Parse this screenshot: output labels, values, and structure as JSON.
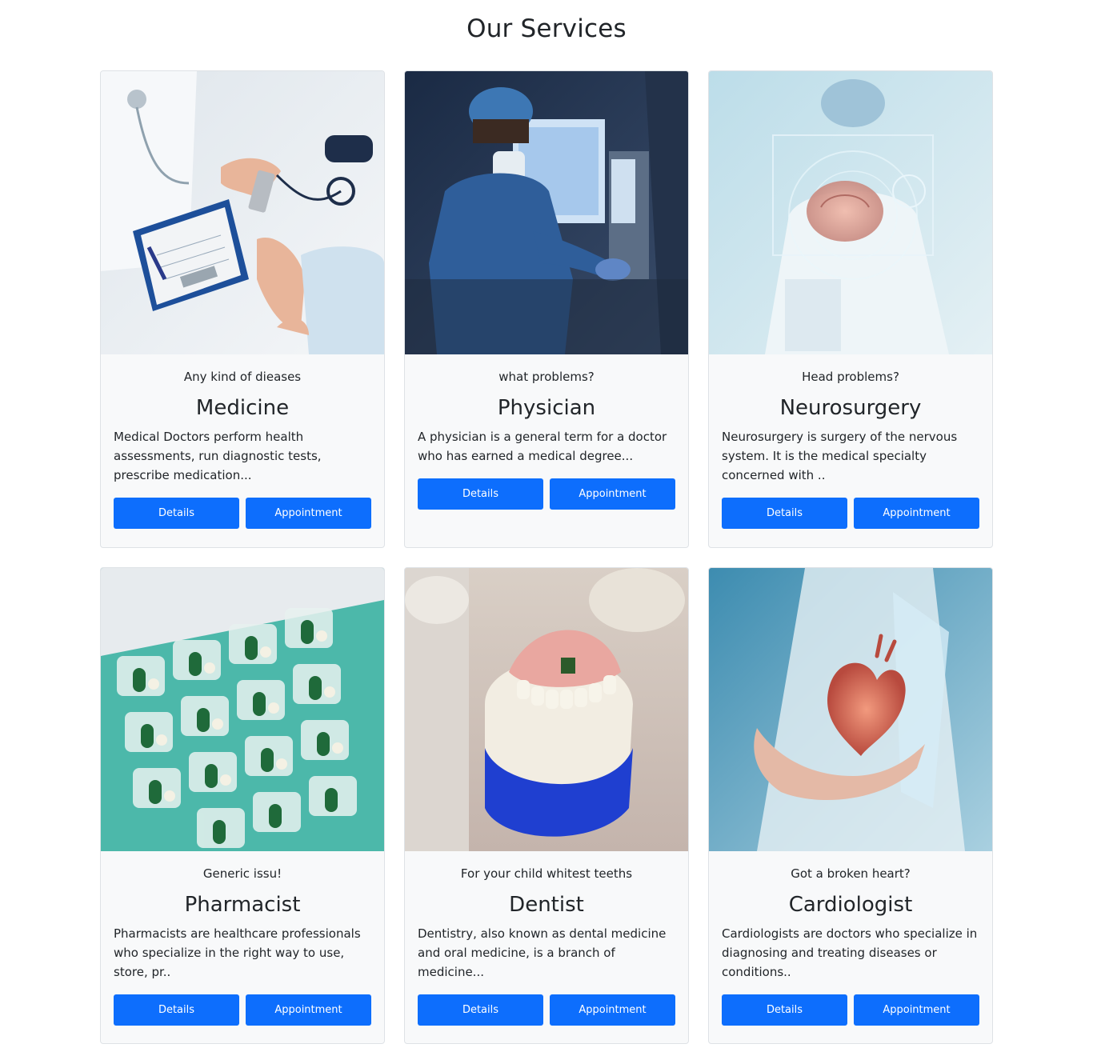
{
  "page": {
    "title": "Our Services"
  },
  "colors": {
    "primary_button": "#0d6efd",
    "card_bg": "#f8f9fa"
  },
  "cards": [
    {
      "tagline": "Any kind of dieases",
      "title": "Medicine",
      "description": "Medical Doctors perform health assessments, run diagnostic tests, prescribe medication...",
      "details_label": "Details",
      "appointment_label": "Appointment",
      "image": "doctor-handing-pills-photo"
    },
    {
      "tagline": "what problems?",
      "title": "Physician",
      "description": "A physician is a general term for a doctor who has earned a medical degree...",
      "details_label": "Details",
      "appointment_label": "Appointment",
      "image": "surgeon-with-monitor-photo"
    },
    {
      "tagline": "Head problems?",
      "title": "Neurosurgery",
      "description": "Neurosurgery is surgery of the nervous system. It is the medical specialty concerned with ..",
      "details_label": "Details",
      "appointment_label": "Appointment",
      "image": "holographic-brain-photo"
    },
    {
      "tagline": "Generic issu!",
      "title": "Pharmacist",
      "description": "Pharmacists are healthcare professionals who specialize in the right way to use, store, pr..",
      "details_label": "Details",
      "appointment_label": "Appointment",
      "image": "capsule-blister-pack-photo"
    },
    {
      "tagline": "For your child whitest teeths",
      "title": "Dentist",
      "description": "Dentistry, also known as dental medicine and oral medicine, is a branch of medicine...",
      "details_label": "Details",
      "appointment_label": "Appointment",
      "image": "denture-model-photo"
    },
    {
      "tagline": "Got a broken heart?",
      "title": "Cardiologist",
      "description": "Cardiologists are doctors who specialize in diagnosing and treating diseases or conditions..",
      "details_label": "Details",
      "appointment_label": "Appointment",
      "image": "hand-holding-heart-photo"
    }
  ]
}
